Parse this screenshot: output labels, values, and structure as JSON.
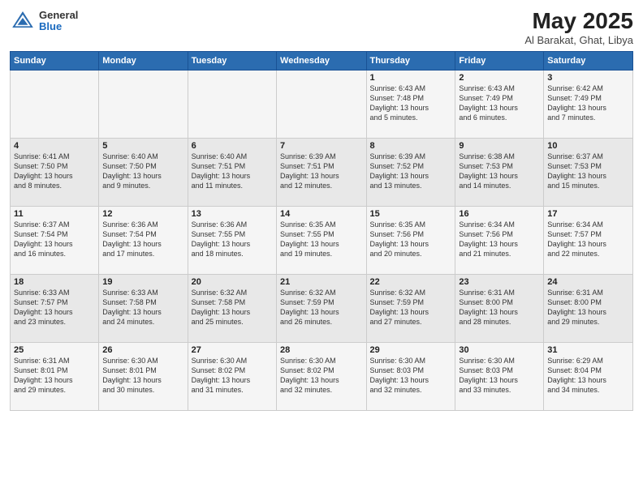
{
  "header": {
    "logo": {
      "general": "General",
      "blue": "Blue"
    },
    "title": "May 2025",
    "location": "Al Barakat, Ghat, Libya"
  },
  "weekdays": [
    "Sunday",
    "Monday",
    "Tuesday",
    "Wednesday",
    "Thursday",
    "Friday",
    "Saturday"
  ],
  "weeks": [
    [
      {
        "day": "",
        "info": ""
      },
      {
        "day": "",
        "info": ""
      },
      {
        "day": "",
        "info": ""
      },
      {
        "day": "",
        "info": ""
      },
      {
        "day": "1",
        "info": "Sunrise: 6:43 AM\nSunset: 7:48 PM\nDaylight: 13 hours\nand 5 minutes."
      },
      {
        "day": "2",
        "info": "Sunrise: 6:43 AM\nSunset: 7:49 PM\nDaylight: 13 hours\nand 6 minutes."
      },
      {
        "day": "3",
        "info": "Sunrise: 6:42 AM\nSunset: 7:49 PM\nDaylight: 13 hours\nand 7 minutes."
      }
    ],
    [
      {
        "day": "4",
        "info": "Sunrise: 6:41 AM\nSunset: 7:50 PM\nDaylight: 13 hours\nand 8 minutes."
      },
      {
        "day": "5",
        "info": "Sunrise: 6:40 AM\nSunset: 7:50 PM\nDaylight: 13 hours\nand 9 minutes."
      },
      {
        "day": "6",
        "info": "Sunrise: 6:40 AM\nSunset: 7:51 PM\nDaylight: 13 hours\nand 11 minutes."
      },
      {
        "day": "7",
        "info": "Sunrise: 6:39 AM\nSunset: 7:51 PM\nDaylight: 13 hours\nand 12 minutes."
      },
      {
        "day": "8",
        "info": "Sunrise: 6:39 AM\nSunset: 7:52 PM\nDaylight: 13 hours\nand 13 minutes."
      },
      {
        "day": "9",
        "info": "Sunrise: 6:38 AM\nSunset: 7:53 PM\nDaylight: 13 hours\nand 14 minutes."
      },
      {
        "day": "10",
        "info": "Sunrise: 6:37 AM\nSunset: 7:53 PM\nDaylight: 13 hours\nand 15 minutes."
      }
    ],
    [
      {
        "day": "11",
        "info": "Sunrise: 6:37 AM\nSunset: 7:54 PM\nDaylight: 13 hours\nand 16 minutes."
      },
      {
        "day": "12",
        "info": "Sunrise: 6:36 AM\nSunset: 7:54 PM\nDaylight: 13 hours\nand 17 minutes."
      },
      {
        "day": "13",
        "info": "Sunrise: 6:36 AM\nSunset: 7:55 PM\nDaylight: 13 hours\nand 18 minutes."
      },
      {
        "day": "14",
        "info": "Sunrise: 6:35 AM\nSunset: 7:55 PM\nDaylight: 13 hours\nand 19 minutes."
      },
      {
        "day": "15",
        "info": "Sunrise: 6:35 AM\nSunset: 7:56 PM\nDaylight: 13 hours\nand 20 minutes."
      },
      {
        "day": "16",
        "info": "Sunrise: 6:34 AM\nSunset: 7:56 PM\nDaylight: 13 hours\nand 21 minutes."
      },
      {
        "day": "17",
        "info": "Sunrise: 6:34 AM\nSunset: 7:57 PM\nDaylight: 13 hours\nand 22 minutes."
      }
    ],
    [
      {
        "day": "18",
        "info": "Sunrise: 6:33 AM\nSunset: 7:57 PM\nDaylight: 13 hours\nand 23 minutes."
      },
      {
        "day": "19",
        "info": "Sunrise: 6:33 AM\nSunset: 7:58 PM\nDaylight: 13 hours\nand 24 minutes."
      },
      {
        "day": "20",
        "info": "Sunrise: 6:32 AM\nSunset: 7:58 PM\nDaylight: 13 hours\nand 25 minutes."
      },
      {
        "day": "21",
        "info": "Sunrise: 6:32 AM\nSunset: 7:59 PM\nDaylight: 13 hours\nand 26 minutes."
      },
      {
        "day": "22",
        "info": "Sunrise: 6:32 AM\nSunset: 7:59 PM\nDaylight: 13 hours\nand 27 minutes."
      },
      {
        "day": "23",
        "info": "Sunrise: 6:31 AM\nSunset: 8:00 PM\nDaylight: 13 hours\nand 28 minutes."
      },
      {
        "day": "24",
        "info": "Sunrise: 6:31 AM\nSunset: 8:00 PM\nDaylight: 13 hours\nand 29 minutes."
      }
    ],
    [
      {
        "day": "25",
        "info": "Sunrise: 6:31 AM\nSunset: 8:01 PM\nDaylight: 13 hours\nand 29 minutes."
      },
      {
        "day": "26",
        "info": "Sunrise: 6:30 AM\nSunset: 8:01 PM\nDaylight: 13 hours\nand 30 minutes."
      },
      {
        "day": "27",
        "info": "Sunrise: 6:30 AM\nSunset: 8:02 PM\nDaylight: 13 hours\nand 31 minutes."
      },
      {
        "day": "28",
        "info": "Sunrise: 6:30 AM\nSunset: 8:02 PM\nDaylight: 13 hours\nand 32 minutes."
      },
      {
        "day": "29",
        "info": "Sunrise: 6:30 AM\nSunset: 8:03 PM\nDaylight: 13 hours\nand 32 minutes."
      },
      {
        "day": "30",
        "info": "Sunrise: 6:30 AM\nSunset: 8:03 PM\nDaylight: 13 hours\nand 33 minutes."
      },
      {
        "day": "31",
        "info": "Sunrise: 6:29 AM\nSunset: 8:04 PM\nDaylight: 13 hours\nand 34 minutes."
      }
    ]
  ]
}
